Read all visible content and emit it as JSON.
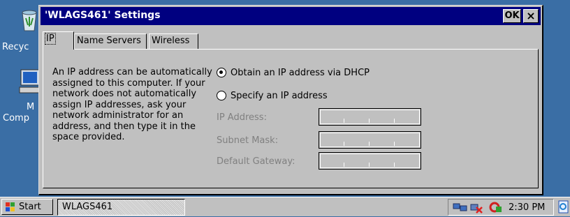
{
  "desktop": {
    "icons": [
      {
        "name": "recycle-bin",
        "label": "Recyc"
      },
      {
        "name": "my-computer",
        "label_line1": "M",
        "label_line2": "Comp"
      }
    ]
  },
  "dialog": {
    "title": "'WLAGS461' Settings",
    "ok_label": "OK",
    "close_label": "×",
    "tabs": [
      {
        "label": "IP",
        "active": true
      },
      {
        "label": "Name Servers",
        "active": false
      },
      {
        "label": "Wireless",
        "active": false
      }
    ],
    "info_text": "An IP address can be automatically assigned to this computer.  If your network does not automatically assign IP addresses, ask your network administrator for an address, and then type it in the space provided.",
    "radio_dhcp": {
      "label": "Obtain an IP address via DHCP",
      "checked": true
    },
    "radio_specify": {
      "label": "Specify an IP address",
      "checked": false
    },
    "fields": [
      {
        "label": "IP Address:",
        "value": ""
      },
      {
        "label": "Subnet Mask:",
        "value": ""
      },
      {
        "label": "Default Gateway:",
        "value": ""
      }
    ]
  },
  "taskbar": {
    "start_label": "Start",
    "task_label": "WLAGS461",
    "clock": "2:30 PM"
  },
  "colors": {
    "desktop": "#3a6ea5",
    "titlebar": "#000080",
    "face": "#c0c0c0"
  }
}
